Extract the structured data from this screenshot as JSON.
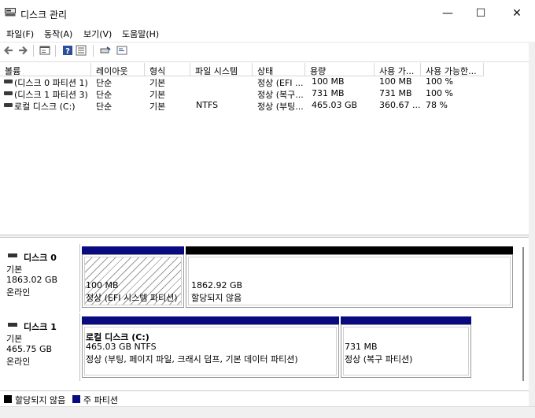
{
  "window": {
    "title": "디스크 관리",
    "min_glyph": "—",
    "max_glyph": "☐",
    "close_glyph": "✕"
  },
  "menu": [
    "파일(F)",
    "동작(A)",
    "보기(V)",
    "도움말(H)"
  ],
  "toolbar_icons": [
    "back-icon",
    "forward-icon",
    "properties-icon",
    "help-icon",
    "disk-view-icon",
    "list-view-icon"
  ],
  "volume_list": {
    "headers": [
      "볼륨",
      "레이아웃",
      "형식",
      "파일 시스템",
      "상태",
      "용량",
      "사용 가...",
      "사용 가능한..."
    ],
    "rows": [
      [
        "(디스크 0 파티션 1)",
        "단순",
        "기본",
        "",
        "정상 (EFI ...",
        "100 MB",
        "100 MB",
        "100 %"
      ],
      [
        "(디스크 1 파티션 3)",
        "단순",
        "기본",
        "",
        "정상 (복구...",
        "731 MB",
        "731 MB",
        "100 %"
      ],
      [
        "로컬 디스크 (C:)",
        "단순",
        "기본",
        "NTFS",
        "정상 (부팅...",
        "465.03 GB",
        "360.67 ...",
        "78 %"
      ]
    ]
  },
  "disks": [
    {
      "name": "디스크 0",
      "type": "기본",
      "size": "1863.02 GB",
      "status": "온라인",
      "partitions": [
        {
          "title": "",
          "size": "100 MB",
          "desc": "정상 (EFI 시스템 파티션)",
          "kind": "primary",
          "hatched": true
        },
        {
          "title": "",
          "size": "1862.92 GB",
          "desc": "할당되지 않음",
          "kind": "unallocated",
          "hatched": false
        }
      ]
    },
    {
      "name": "디스크 1",
      "type": "기본",
      "size": "465.75 GB",
      "status": "온라인",
      "partitions": [
        {
          "title": "로컬 디스크  (C:)",
          "size": "465.03 GB NTFS",
          "desc": "정상 (부팅, 페이지 파일, 크래시 덤프, 기본 데이터 파티션)",
          "kind": "primary",
          "hatched": false
        },
        {
          "title": "",
          "size": "731 MB",
          "desc": "정상 (복구 파티션)",
          "kind": "primary",
          "hatched": false
        }
      ]
    }
  ],
  "legend": [
    {
      "label": "할당되지 않음",
      "color": "#000000"
    },
    {
      "label": "주 파티션",
      "color": "#0a0a80"
    }
  ],
  "colors": {
    "primary": "#0a0a80",
    "unallocated": "#000000"
  }
}
